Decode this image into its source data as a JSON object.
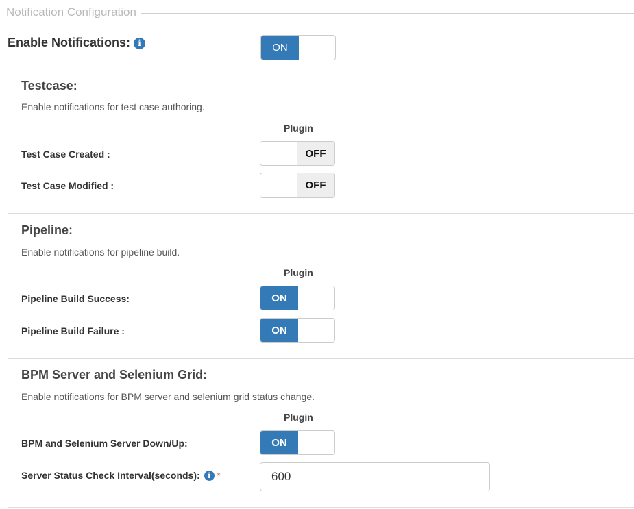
{
  "legend": "Notification Configuration",
  "enable": {
    "label": "Enable Notifications:",
    "info_icon": "info-icon",
    "state": "ON"
  },
  "testcase": {
    "title": "Testcase:",
    "description": "Enable notifications for test case authoring.",
    "column": "Plugin",
    "rows": [
      {
        "label": "Test Case Created :",
        "state": "OFF"
      },
      {
        "label": "Test Case Modified :",
        "state": "OFF"
      }
    ]
  },
  "pipeline": {
    "title": "Pipeline:",
    "description": "Enable notifications for pipeline build.",
    "column": "Plugin",
    "rows": [
      {
        "label": "Pipeline Build Success:",
        "state": "ON"
      },
      {
        "label": "Pipeline Build Failure :",
        "state": "ON"
      }
    ]
  },
  "bpm": {
    "title": "BPM Server and Selenium Grid:",
    "description": "Enable notifications for BPM server and selenium grid status change.",
    "column": "Plugin",
    "rows": [
      {
        "label": "BPM and Selenium Server Down/Up:",
        "state": "ON"
      }
    ],
    "interval": {
      "label": "Server Status Check Interval(seconds):",
      "required_mark": "*",
      "value": "600"
    }
  },
  "colors": {
    "accent": "#337ab7",
    "off_bg": "#eeeeee",
    "required": "#d9534f"
  }
}
